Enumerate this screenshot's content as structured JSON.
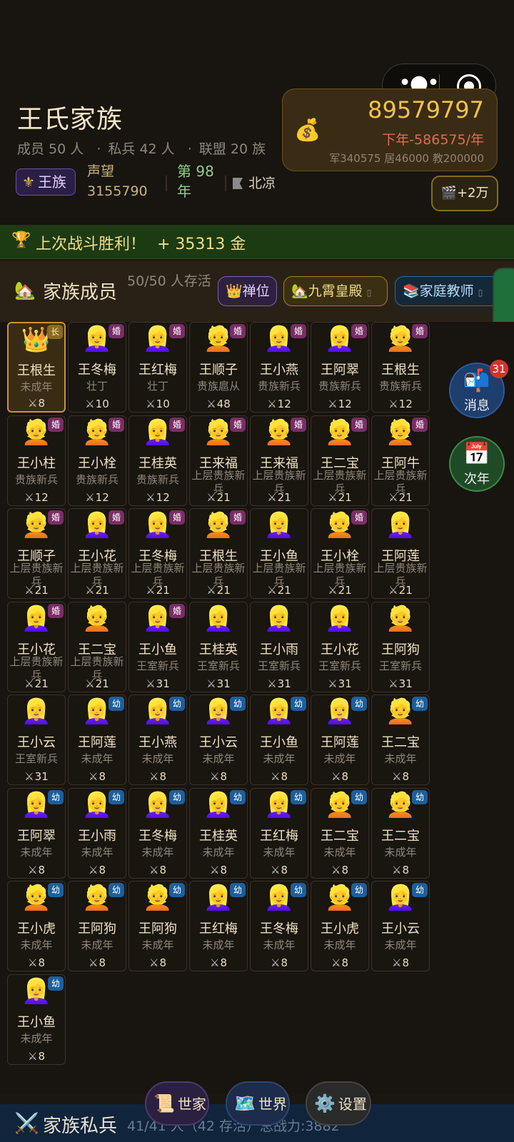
{
  "header": {
    "clan_title": "王氏家族",
    "members_label": "成员 50 人",
    "troops_label": "私兵 42 人",
    "alliance_label": "联盟 20 族",
    "dot": "·",
    "royal_badge": "王族",
    "prestige_label": "声望",
    "prestige_value": "3155790",
    "year_label": "第 98 年",
    "city": "北凉",
    "gold": "89579797",
    "income": "下年-586575/年",
    "income_detail": "军340575 居46000 教200000",
    "bonus_button": "+2万"
  },
  "victory": {
    "text": "上次战斗胜利！",
    "reward": "+ 35313 金"
  },
  "members_section": {
    "title": "家族成员",
    "count": "50/50 人存活",
    "abdicate": "禅位",
    "palace": "九霄皇殿",
    "teacher": "家庭教师"
  },
  "members": [
    {
      "name": "王根生",
      "role": "未成年",
      "power": "8",
      "face": "👑",
      "tag": "长",
      "tag_type": "lead",
      "leader": true
    },
    {
      "name": "王冬梅",
      "role": "壮丁",
      "power": "10",
      "face": "👱‍♀️",
      "tag": "婚",
      "tag_type": "marry"
    },
    {
      "name": "王红梅",
      "role": "壮丁",
      "power": "10",
      "face": "👱‍♀️",
      "tag": "婚",
      "tag_type": "marry"
    },
    {
      "name": "王顺子",
      "role": "贵族扈从",
      "power": "48",
      "face": "👱",
      "tag": "婚",
      "tag_type": "marry"
    },
    {
      "name": "王小燕",
      "role": "贵族新兵",
      "power": "12",
      "face": "👱‍♀️",
      "tag": "婚",
      "tag_type": "marry"
    },
    {
      "name": "王阿翠",
      "role": "贵族新兵",
      "power": "12",
      "face": "👱‍♀️",
      "tag": "婚",
      "tag_type": "marry"
    },
    {
      "name": "王根生",
      "role": "贵族新兵",
      "power": "12",
      "face": "👱",
      "tag": "婚",
      "tag_type": "marry"
    },
    {
      "name": "王小柱",
      "role": "贵族新兵",
      "power": "12",
      "face": "👱",
      "tag": "婚",
      "tag_type": "marry"
    },
    {
      "name": "王小栓",
      "role": "贵族新兵",
      "power": "12",
      "face": "👱",
      "tag": "婚",
      "tag_type": "marry"
    },
    {
      "name": "王桂英",
      "role": "贵族新兵",
      "power": "12",
      "face": "👱‍♀️",
      "tag": "婚",
      "tag_type": "marry"
    },
    {
      "name": "王来福",
      "role": "上层贵族新兵",
      "power": "21",
      "face": "👱",
      "tag": "婚",
      "tag_type": "marry"
    },
    {
      "name": "王来福",
      "role": "上层贵族新兵",
      "power": "21",
      "face": "👱",
      "tag": "婚",
      "tag_type": "marry"
    },
    {
      "name": "王二宝",
      "role": "上层贵族新兵",
      "power": "21",
      "face": "👱",
      "tag": "婚",
      "tag_type": "marry"
    },
    {
      "name": "王阿牛",
      "role": "上层贵族新兵",
      "power": "21",
      "face": "👱",
      "tag": "婚",
      "tag_type": "marry"
    },
    {
      "name": "王顺子",
      "role": "上层贵族新兵",
      "power": "21",
      "face": "👱",
      "tag": "婚",
      "tag_type": "marry"
    },
    {
      "name": "王小花",
      "role": "上层贵族新兵",
      "power": "21",
      "face": "👱‍♀️",
      "tag": "婚",
      "tag_type": "marry"
    },
    {
      "name": "王冬梅",
      "role": "上层贵族新兵",
      "power": "21",
      "face": "👱‍♀️",
      "tag": "婚",
      "tag_type": "marry"
    },
    {
      "name": "王根生",
      "role": "上层贵族新兵",
      "power": "21",
      "face": "👱",
      "tag": "婚",
      "tag_type": "marry"
    },
    {
      "name": "王小鱼",
      "role": "上层贵族新兵",
      "power": "21",
      "face": "👱‍♀️",
      "tag": "",
      "tag_type": ""
    },
    {
      "name": "王小栓",
      "role": "上层贵族新兵",
      "power": "21",
      "face": "👱",
      "tag": "婚",
      "tag_type": "marry"
    },
    {
      "name": "王阿莲",
      "role": "上层贵族新兵",
      "power": "21",
      "face": "👱‍♀️",
      "tag": "",
      "tag_type": ""
    },
    {
      "name": "王小花",
      "role": "上层贵族新兵",
      "power": "21",
      "face": "👱‍♀️",
      "tag": "婚",
      "tag_type": "marry"
    },
    {
      "name": "王二宝",
      "role": "上层贵族新兵",
      "power": "21",
      "face": "👱",
      "tag": "",
      "tag_type": ""
    },
    {
      "name": "王小鱼",
      "role": "王室新兵",
      "power": "31",
      "face": "👱‍♀️",
      "tag": "婚",
      "tag_type": "marry"
    },
    {
      "name": "王桂英",
      "role": "王室新兵",
      "power": "31",
      "face": "👱‍♀️",
      "tag": "",
      "tag_type": ""
    },
    {
      "name": "王小雨",
      "role": "王室新兵",
      "power": "31",
      "face": "👱‍♀️",
      "tag": "",
      "tag_type": ""
    },
    {
      "name": "王小花",
      "role": "王室新兵",
      "power": "31",
      "face": "👱‍♀️",
      "tag": "",
      "tag_type": ""
    },
    {
      "name": "王阿狗",
      "role": "王室新兵",
      "power": "31",
      "face": "👱",
      "tag": "",
      "tag_type": ""
    },
    {
      "name": "王小云",
      "role": "王室新兵",
      "power": "31",
      "face": "👱‍♀️",
      "tag": "",
      "tag_type": ""
    },
    {
      "name": "王阿莲",
      "role": "未成年",
      "power": "8",
      "face": "👱‍♀️",
      "tag": "幼",
      "tag_type": "young"
    },
    {
      "name": "王小燕",
      "role": "未成年",
      "power": "8",
      "face": "👱‍♀️",
      "tag": "幼",
      "tag_type": "young"
    },
    {
      "name": "王小云",
      "role": "未成年",
      "power": "8",
      "face": "👱‍♀️",
      "tag": "幼",
      "tag_type": "young"
    },
    {
      "name": "王小鱼",
      "role": "未成年",
      "power": "8",
      "face": "👱‍♀️",
      "tag": "幼",
      "tag_type": "young"
    },
    {
      "name": "王阿莲",
      "role": "未成年",
      "power": "8",
      "face": "👱‍♀️",
      "tag": "幼",
      "tag_type": "young"
    },
    {
      "name": "王二宝",
      "role": "未成年",
      "power": "8",
      "face": "👱",
      "tag": "幼",
      "tag_type": "young"
    },
    {
      "name": "王阿翠",
      "role": "未成年",
      "power": "8",
      "face": "👱‍♀️",
      "tag": "幼",
      "tag_type": "young"
    },
    {
      "name": "王小雨",
      "role": "未成年",
      "power": "8",
      "face": "👱‍♀️",
      "tag": "幼",
      "tag_type": "young"
    },
    {
      "name": "王冬梅",
      "role": "未成年",
      "power": "8",
      "face": "👱‍♀️",
      "tag": "幼",
      "tag_type": "young"
    },
    {
      "name": "王桂英",
      "role": "未成年",
      "power": "8",
      "face": "👱‍♀️",
      "tag": "幼",
      "tag_type": "young"
    },
    {
      "name": "王红梅",
      "role": "未成年",
      "power": "8",
      "face": "👱‍♀️",
      "tag": "幼",
      "tag_type": "young"
    },
    {
      "name": "王二宝",
      "role": "未成年",
      "power": "8",
      "face": "👱",
      "tag": "幼",
      "tag_type": "young"
    },
    {
      "name": "王二宝",
      "role": "未成年",
      "power": "8",
      "face": "👱",
      "tag": "幼",
      "tag_type": "young"
    },
    {
      "name": "王小虎",
      "role": "未成年",
      "power": "8",
      "face": "👱",
      "tag": "幼",
      "tag_type": "young"
    },
    {
      "name": "王阿狗",
      "role": "未成年",
      "power": "8",
      "face": "👱",
      "tag": "幼",
      "tag_type": "young"
    },
    {
      "name": "王阿狗",
      "role": "未成年",
      "power": "8",
      "face": "👱",
      "tag": "幼",
      "tag_type": "young"
    },
    {
      "name": "王红梅",
      "role": "未成年",
      "power": "8",
      "face": "👱‍♀️",
      "tag": "幼",
      "tag_type": "young"
    },
    {
      "name": "王冬梅",
      "role": "未成年",
      "power": "8",
      "face": "👱‍♀️",
      "tag": "幼",
      "tag_type": "young"
    },
    {
      "name": "王小虎",
      "role": "未成年",
      "power": "8",
      "face": "👱",
      "tag": "幼",
      "tag_type": "young"
    },
    {
      "name": "王小云",
      "role": "未成年",
      "power": "8",
      "face": "👱‍♀️",
      "tag": "幼",
      "tag_type": "young"
    },
    {
      "name": "王小鱼",
      "role": "未成年",
      "power": "8",
      "face": "👱‍♀️",
      "tag": "幼",
      "tag_type": "young"
    }
  ],
  "side_buttons": {
    "messages": "消息",
    "messages_badge": "31",
    "next_year": "次年"
  },
  "bottom": {
    "troops_title": "家族私兵",
    "troops_info": "41/41 人（42 存活）总战力:3882",
    "nav_shijia": "世家",
    "nav_world": "世界",
    "nav_settings": "设置"
  },
  "icons": {
    "power_icon": "swords-icon"
  }
}
